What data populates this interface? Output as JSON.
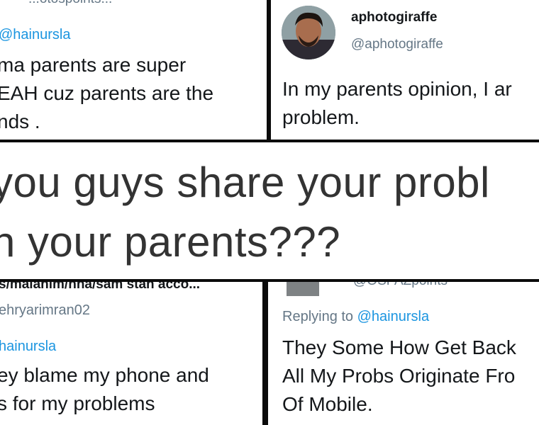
{
  "top_left": {
    "header_partial": "...otospoints...",
    "reply_handle": "@hainursla",
    "lines": [
      "ma parents are super",
      "EAH cuz parents are the",
      "nds ."
    ]
  },
  "top_right": {
    "name": "aphotogiraffe",
    "handle": "@aphotogiraffe",
    "lines": [
      "In my parents opinion, I ar",
      "problem."
    ]
  },
  "banner": {
    "line1": "you guys share your probl",
    "line2": "h your parents???"
  },
  "bottom_left": {
    "header_partial": "s/malahim/nha/sam stan acco...",
    "handle": "ehryarimran02",
    "reply_handle": "hainursla",
    "lines": [
      "ey blame my phone and",
      "s for my problems"
    ]
  },
  "bottom_right": {
    "header_partial": "@OSPAZpoints",
    "replying_prefix": "Replying to",
    "replying_handle": "@hainursla",
    "lines": [
      "They Some How Get Back",
      "All My Probs Originate Fro",
      "Of Mobile."
    ]
  },
  "colors": {
    "link": "#1b95e0",
    "text": "#14171a",
    "muted": "#657786"
  }
}
